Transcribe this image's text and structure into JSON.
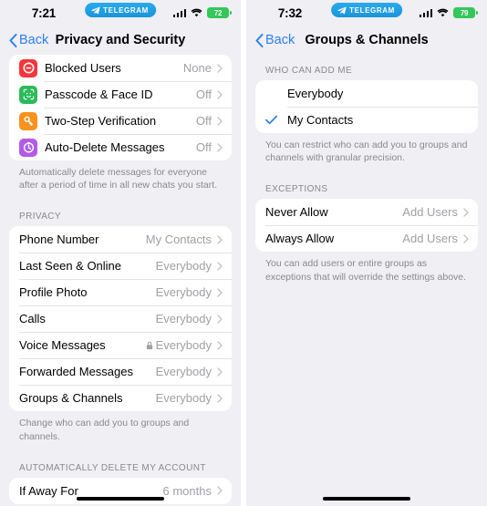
{
  "screens": [
    {
      "status": {
        "time": "7:21",
        "brand": "TELEGRAM",
        "brand_icon": "paper-plane-icon",
        "signal_icon": "cellular-bars-icon",
        "wifi_icon": "wifi-icon",
        "battery": "72"
      },
      "nav": {
        "back": "Back",
        "title": "Privacy and Security"
      },
      "group1": {
        "rows": [
          {
            "label": "Blocked Users",
            "value": "None",
            "icon": "block-user-icon",
            "color": "#f6343a"
          },
          {
            "label": "Passcode & Face ID",
            "value": "Off",
            "icon": "face-id-icon",
            "color": "#2bbb5a"
          },
          {
            "label": "Two-Step Verification",
            "value": "Off",
            "icon": "key-icon",
            "color": "#f7921e"
          },
          {
            "label": "Auto-Delete Messages",
            "value": "Off",
            "icon": "timer-icon",
            "color": "#b05ce6"
          }
        ]
      },
      "footnote1": "Automatically delete messages for everyone after a period of time in all new chats you start.",
      "privacy_header": "PRIVACY",
      "group2": {
        "rows": [
          {
            "label": "Phone Number",
            "value": "My Contacts",
            "lock": false
          },
          {
            "label": "Last Seen & Online",
            "value": "Everybody",
            "lock": false
          },
          {
            "label": "Profile Photo",
            "value": "Everybody",
            "lock": false
          },
          {
            "label": "Calls",
            "value": "Everybody",
            "lock": false
          },
          {
            "label": "Voice Messages",
            "value": "Everybody",
            "lock": true
          },
          {
            "label": "Forwarded Messages",
            "value": "Everybody",
            "lock": false
          },
          {
            "label": "Groups & Channels",
            "value": "Everybody",
            "lock": false
          }
        ]
      },
      "footnote2": "Change who can add you to groups and channels.",
      "delete_header": "AUTOMATICALLY DELETE MY ACCOUNT",
      "group3": {
        "rows": [
          {
            "label": "If Away For",
            "value": "6 months"
          }
        ]
      }
    },
    {
      "status": {
        "time": "7:32",
        "brand": "TELEGRAM",
        "brand_icon": "paper-plane-icon",
        "signal_icon": "cellular-bars-icon",
        "wifi_icon": "wifi-icon",
        "battery": "79"
      },
      "nav": {
        "back": "Back",
        "title": "Groups & Channels"
      },
      "who_header": "WHO CAN ADD ME",
      "who_options": [
        {
          "label": "Everybody",
          "selected": false
        },
        {
          "label": "My Contacts",
          "selected": true
        }
      ],
      "who_footnote": "You can restrict who can add you to groups and channels with granular precision.",
      "exceptions_header": "EXCEPTIONS",
      "exceptions": [
        {
          "label": "Never Allow",
          "value": "Add Users"
        },
        {
          "label": "Always Allow",
          "value": "Add Users"
        }
      ],
      "exceptions_footnote": "You can add users or entire groups as exceptions that will override the settings above."
    }
  ],
  "colors": {
    "accent": "#2f80ed",
    "check": "#2f80ed",
    "background": "#efeff4",
    "card": "#ffffff",
    "battery_green": "#34c759",
    "secondary_text": "#a0a0a6"
  }
}
